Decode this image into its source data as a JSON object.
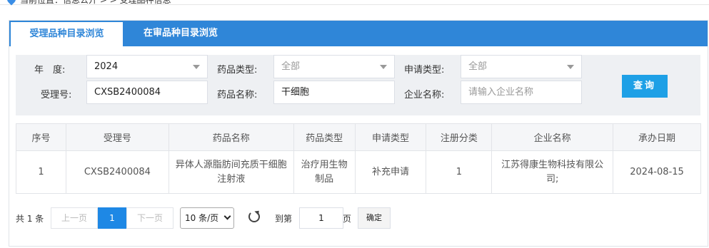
{
  "breadcrumb": {
    "text": "当前位置：信息公开 > > 受理品种信息"
  },
  "tabs": [
    {
      "label": "受理品种目录浏览"
    },
    {
      "label": "在审品种目录浏览"
    }
  ],
  "search": {
    "year_label": "年　度:",
    "year_value": "2024",
    "drug_type_label": "药品类型:",
    "drug_type_value": "全部",
    "apply_type_label": "申请类型:",
    "apply_type_value": "全部",
    "accept_no_label": "受理号:",
    "accept_no_value": "CXSB2400084",
    "drug_name_label": "药品名称:",
    "drug_name_value": "干细胞",
    "company_label": "企业名称:",
    "company_placeholder": "请输入企业名称",
    "query_label": "查询"
  },
  "table": {
    "headers": [
      "序号",
      "受理号",
      "药品名称",
      "药品类型",
      "申请类型",
      "注册分类",
      "企业名称",
      "承办日期"
    ],
    "rows": [
      [
        "1",
        "CXSB2400084",
        "异体人源脂肪间充质干细胞注射液",
        "治疗用生物制品",
        "补充申请",
        "1",
        "江苏得康生物科技有限公司;",
        "2024-08-15"
      ]
    ]
  },
  "pager": {
    "total": "共 1 条",
    "prev": "上一页",
    "page": "1",
    "next": "下一页",
    "page_size": "10 条/页",
    "goto_label": "到第",
    "goto_value": "1",
    "page_unit": "页",
    "confirm": "确定"
  }
}
